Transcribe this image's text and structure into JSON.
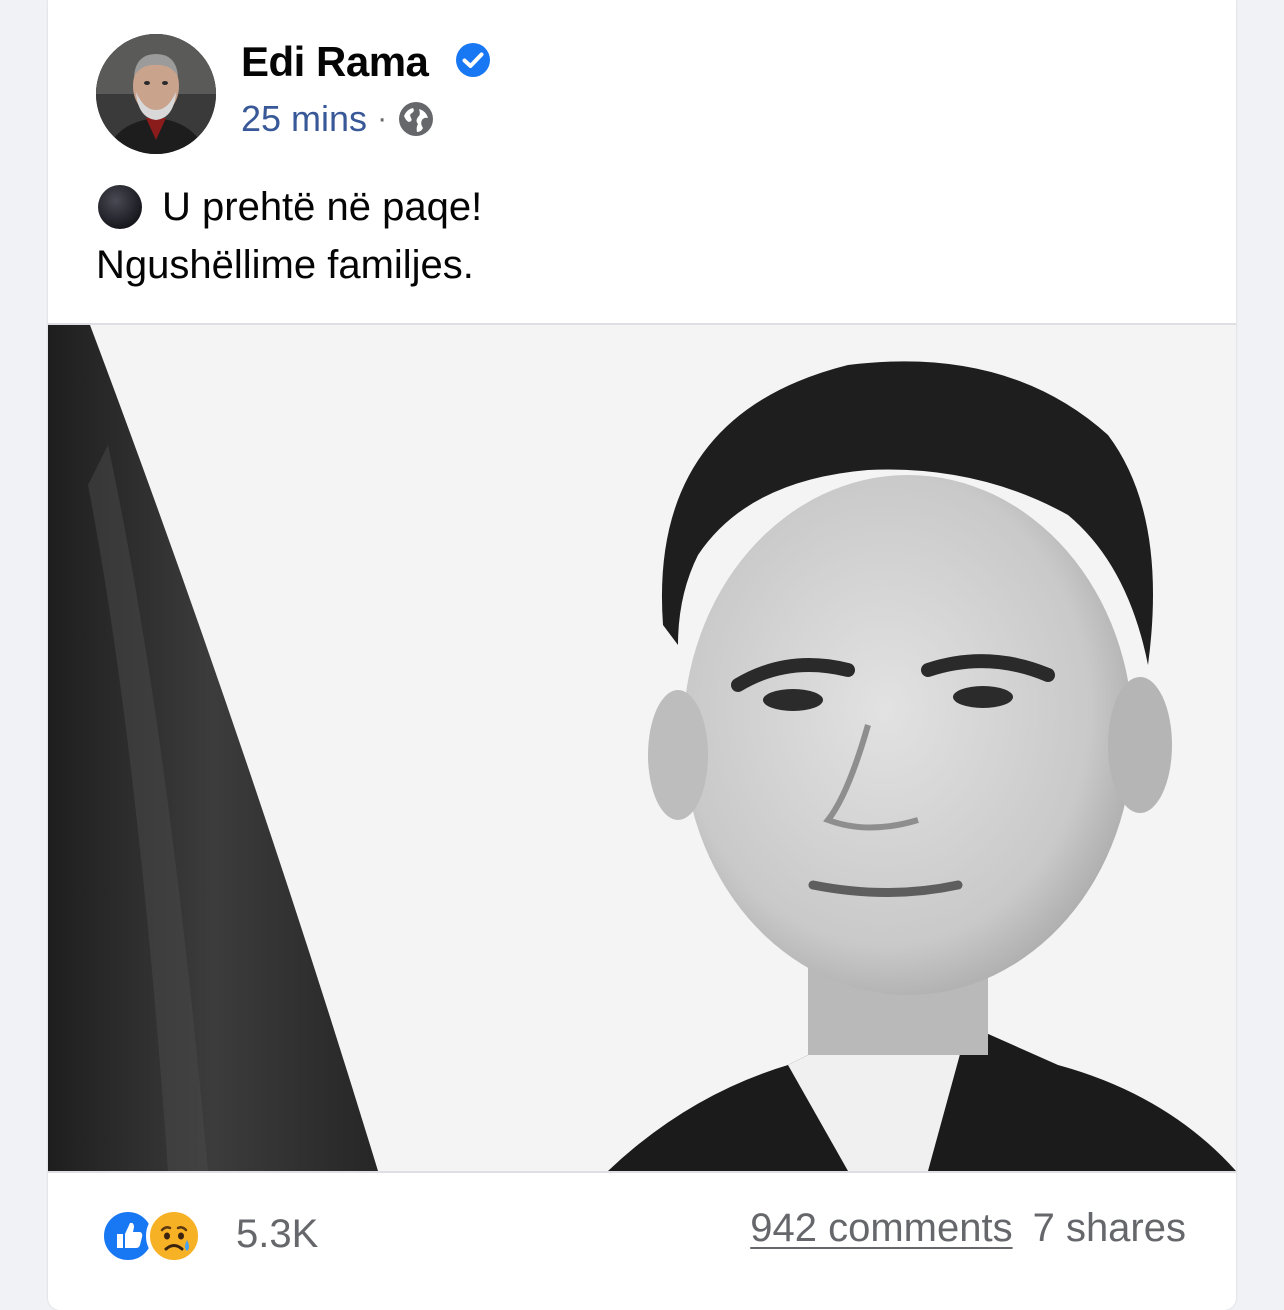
{
  "post": {
    "author": {
      "name": "Edi Rama",
      "verified": true,
      "verified_color": "#1877f2"
    },
    "timestamp": "25 mins",
    "separator": "·",
    "audience_icon": "globe-icon",
    "text": {
      "emoji": "black-circle-icon",
      "line1": "U prehtë në paqe!",
      "line2": "Ngushëllime familjes."
    },
    "photo": {
      "style": "black-and-white"
    },
    "reactions": {
      "icons": [
        "like-icon",
        "sad-icon"
      ],
      "count": "5.3K"
    },
    "comments_label": "942 comments",
    "shares_label": "7 shares"
  }
}
